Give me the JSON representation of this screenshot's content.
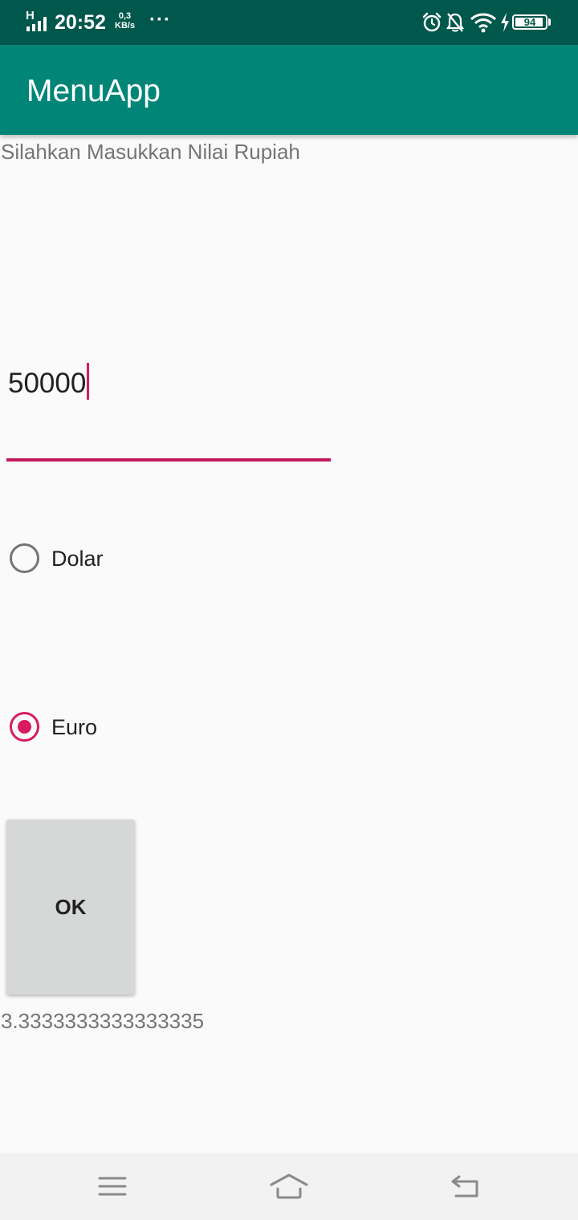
{
  "status_bar": {
    "network_type": "H",
    "time": "20:52",
    "speed_value": "0,3",
    "speed_unit": "KB/s",
    "more": "···",
    "battery_level": "94",
    "battery_fill_percent": 94,
    "icons": [
      "signal-icon",
      "alarm-icon",
      "notifications-off-icon",
      "wifi-icon",
      "charging-icon",
      "battery-icon"
    ],
    "background_color": "#00574b"
  },
  "app_bar": {
    "title": "MenuApp",
    "background_color": "#008577"
  },
  "form": {
    "prompt_label": "Silahkan Masukkan Nilai Rupiah",
    "amount_value": "50000",
    "accent_color": "#d81b60",
    "options": [
      {
        "label": "Dolar",
        "checked": false
      },
      {
        "label": "Euro",
        "checked": true
      }
    ],
    "ok_label": "OK",
    "result": "3.3333333333333335"
  },
  "nav_bar": {
    "icons": [
      "menu-icon",
      "home-icon",
      "back-icon"
    ]
  }
}
